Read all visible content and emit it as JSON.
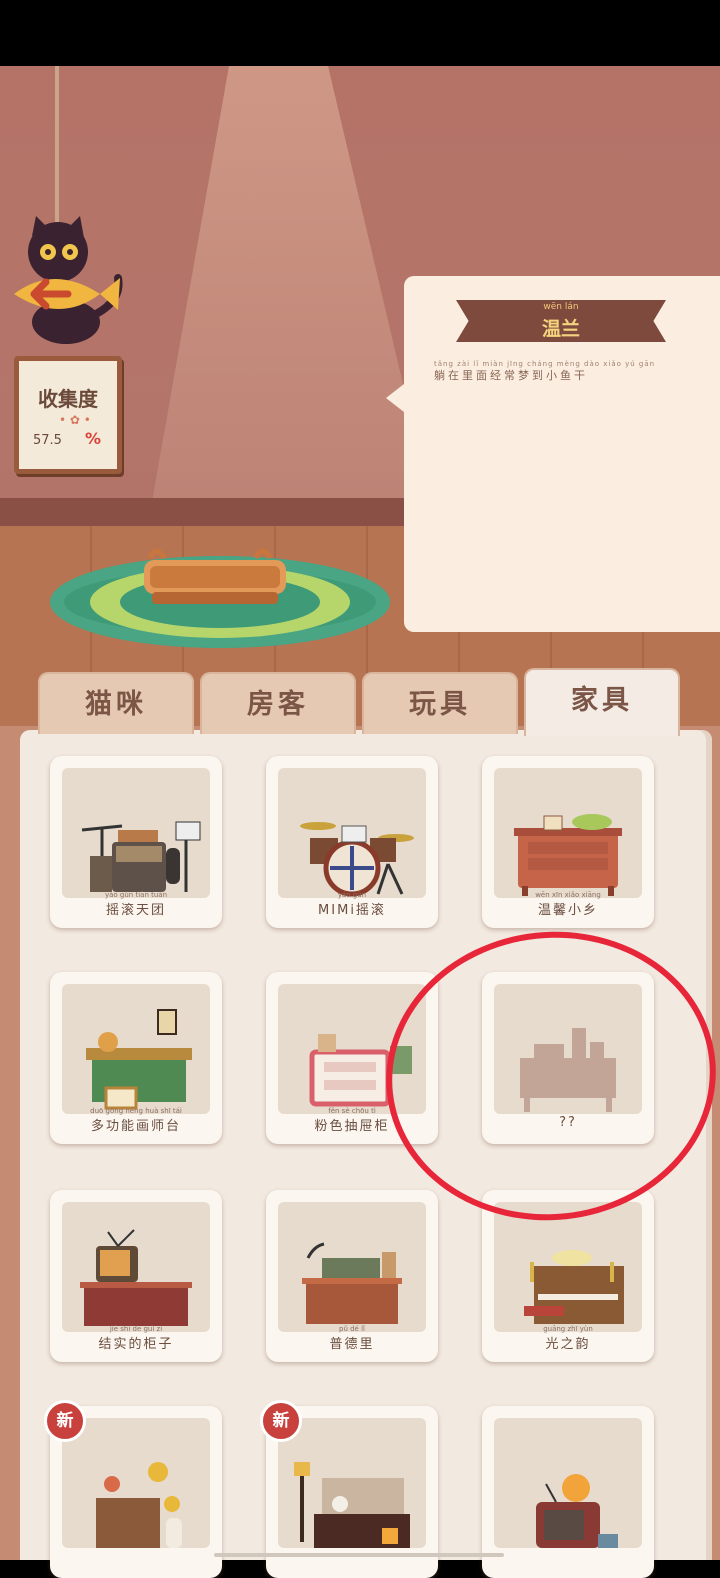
{
  "scene": {
    "collection": {
      "title": "收集度",
      "value": "57.5",
      "unit": "%"
    }
  },
  "detail": {
    "name_pinyin": "wēn lán",
    "name": "温兰",
    "desc_pinyin": "tǎng zài  lǐ  miàn jīng cháng mèng dào  xiǎo  yú  gān",
    "desc": "躺在里面经常梦到小鱼干"
  },
  "tabs": [
    {
      "label": "猫咪"
    },
    {
      "label": "房客"
    },
    {
      "label": "玩具"
    },
    {
      "label": "家具"
    }
  ],
  "items": [
    {
      "pinyin": "yáo  gǔn tiān tuán",
      "name": "摇滚天团"
    },
    {
      "pinyin": "yáo  gǔn",
      "name": "MIMi摇滚"
    },
    {
      "pinyin": "wēn  xīn  xiǎo xiāng",
      "name": "温馨小乡"
    },
    {
      "pinyin": "duō gōng néng huà  shī  tái",
      "name": "多功能画师台"
    },
    {
      "pinyin": "fěn  sè  chōu  tì",
      "name": "粉色抽屉柜"
    },
    {
      "pinyin": "",
      "name": "??"
    },
    {
      "pinyin": "jiē  shí  de  guì  zi",
      "name": "结实的柜子"
    },
    {
      "pinyin": "pǔ  dé  lǐ",
      "name": "普德里"
    },
    {
      "pinyin": "guāng zhī  yùn",
      "name": "光之韵"
    },
    {
      "pinyin": "",
      "name": "",
      "badge": "新"
    },
    {
      "pinyin": "",
      "name": "",
      "badge": "新"
    },
    {
      "pinyin": "",
      "name": ""
    }
  ],
  "colors": {
    "accent": "#e8263a",
    "wall": "#b57367",
    "ribbon": "#7f4a3e"
  }
}
